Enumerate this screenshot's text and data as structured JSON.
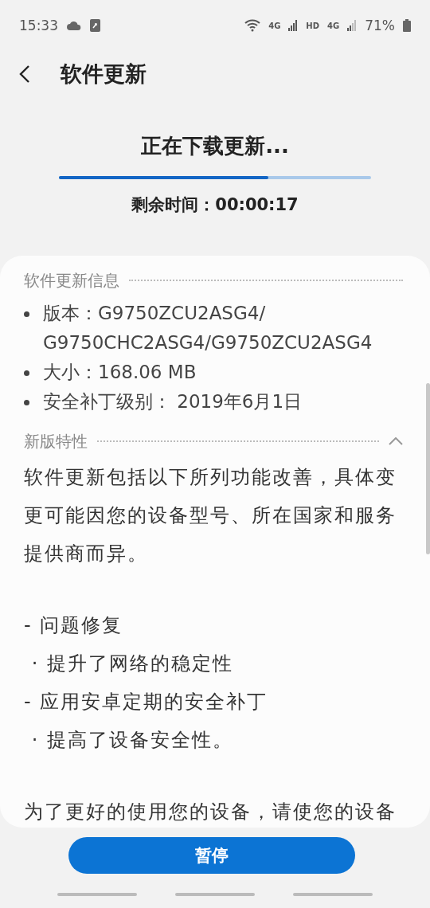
{
  "status_bar": {
    "time": "15:33",
    "battery": "71%",
    "network_1": "4G",
    "hd": "HD",
    "network_2": "4G"
  },
  "header": {
    "title": "软件更新"
  },
  "download": {
    "title": "正在下载更新...",
    "level": 0.67,
    "remaining": "剩余时间：00:00:17"
  },
  "info": {
    "heading": "软件更新信息",
    "items": [
      {
        "text": "版本：G9750ZCU2ASG4/\nG9750CHC2ASG4/G9750ZCU2ASG4"
      },
      {
        "text": "大小：168.06 MB"
      },
      {
        "text": "安全补丁级别： 2019年6月1日"
      }
    ]
  },
  "features": {
    "heading": "新版特性",
    "expanded": true,
    "blocks": [
      [
        "软件更新包括以下所列功能改善，具体变更可能因您的设备型号、所在国家和服务提供商而异。"
      ],
      [
        "- 问题修复",
        " · 提升了网络的稳定性",
        "- 应用安卓定期的安全补丁",
        " · 提高了设备安全性。"
      ],
      [
        "为了更好的使用您的设备，请使您的设备"
      ]
    ]
  },
  "button": {
    "label": "暂停"
  }
}
